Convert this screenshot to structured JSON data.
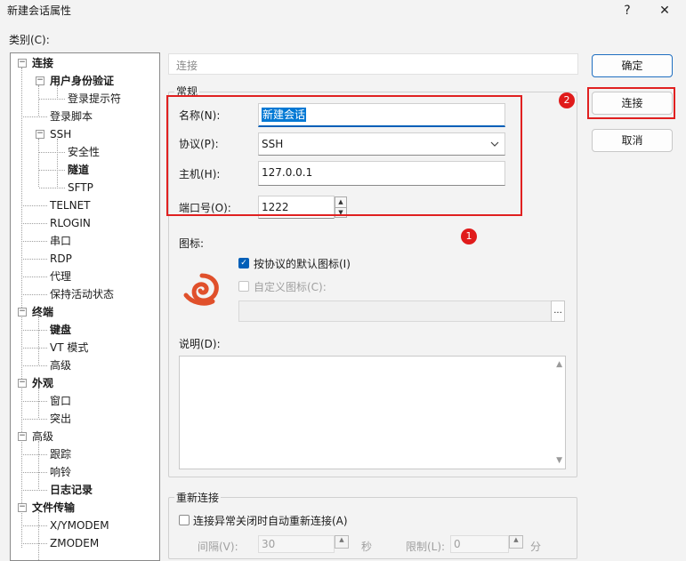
{
  "window": {
    "title": "新建会话属性",
    "help_label": "?",
    "close_label": "✕"
  },
  "category_label": "类别(C):",
  "tree": [
    {
      "label": "连接",
      "bold": true,
      "expander": "−"
    },
    {
      "label": "用户身份验证",
      "bold": true,
      "expander": "−"
    },
    {
      "label": "登录提示符",
      "bold": false
    },
    {
      "label": "登录脚本",
      "bold": false
    },
    {
      "label": "SSH",
      "bold": false,
      "expander": "−"
    },
    {
      "label": "安全性",
      "bold": false
    },
    {
      "label": "隧道",
      "bold": true
    },
    {
      "label": "SFTP",
      "bold": false
    },
    {
      "label": "TELNET",
      "bold": false
    },
    {
      "label": "RLOGIN",
      "bold": false
    },
    {
      "label": "串口",
      "bold": false
    },
    {
      "label": "RDP",
      "bold": false
    },
    {
      "label": "代理",
      "bold": false
    },
    {
      "label": "保持活动状态",
      "bold": false
    },
    {
      "label": "终端",
      "bold": true,
      "expander": "−"
    },
    {
      "label": "键盘",
      "bold": true
    },
    {
      "label": "VT 模式",
      "bold": false
    },
    {
      "label": "高级",
      "bold": false
    },
    {
      "label": "外观",
      "bold": true,
      "expander": "−"
    },
    {
      "label": "窗口",
      "bold": false
    },
    {
      "label": "突出",
      "bold": false
    },
    {
      "label": "高级",
      "bold": false,
      "expander": "−"
    },
    {
      "label": "跟踪",
      "bold": false
    },
    {
      "label": "响铃",
      "bold": false
    },
    {
      "label": "日志记录",
      "bold": true
    },
    {
      "label": "文件传输",
      "bold": true,
      "expander": "−"
    },
    {
      "label": "X/YMODEM",
      "bold": false
    },
    {
      "label": "ZMODEM",
      "bold": false
    }
  ],
  "breadcrumb": "连接",
  "general": {
    "legend": "常规",
    "name_label": "名称(N):",
    "name_value": "新建会话",
    "protocol_label": "协议(P):",
    "protocol_value": "SSH",
    "host_label": "主机(H):",
    "host_value": "127.0.0.1",
    "port_label": "端口号(O):",
    "port_value": "1222"
  },
  "icon_section": {
    "label": "图标:",
    "default_icon_label": "按协议的默认图标(I)",
    "default_icon_checked": true,
    "custom_icon_label": "自定义图标(C):",
    "custom_icon_checked": false,
    "browse_label": "..."
  },
  "description": {
    "label": "说明(D):",
    "value": ""
  },
  "reconnect": {
    "legend": "重新连接",
    "auto_reconnect_label": "连接异常关闭时自动重新连接(A)",
    "auto_reconnect_checked": false,
    "interval_label": "间隔(V):",
    "interval_value": "30",
    "seconds_label": "秒",
    "limit_label": "限制(L):",
    "limit_value": "0",
    "minutes_label": "分"
  },
  "buttons": {
    "ok": "确定",
    "connect": "连接",
    "cancel": "取消"
  },
  "annotations": {
    "badge1": "1",
    "badge2": "2",
    "color": "#e02020"
  }
}
